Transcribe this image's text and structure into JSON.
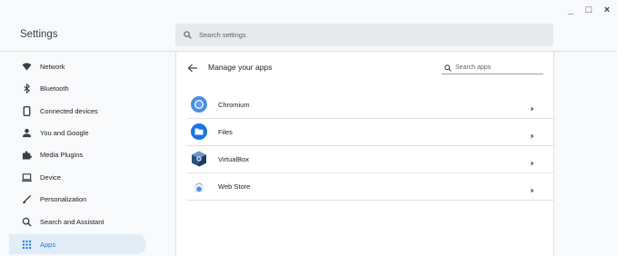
{
  "window": {
    "minimize": "_",
    "maximize": "□",
    "close": "×"
  },
  "header": {
    "title": "Settings",
    "search_placeholder": "Search settings"
  },
  "sidebar": {
    "items": [
      {
        "label": "Network",
        "icon": "wifi-icon"
      },
      {
        "label": "Bluetooth",
        "icon": "bluetooth-icon"
      },
      {
        "label": "Connected devices",
        "icon": "phone-icon"
      },
      {
        "label": "You and Google",
        "icon": "person-icon"
      },
      {
        "label": "Media Plugins",
        "icon": "puzzle-icon"
      },
      {
        "label": "Device",
        "icon": "laptop-icon"
      },
      {
        "label": "Personalization",
        "icon": "brush-icon"
      },
      {
        "label": "Search and Assistant",
        "icon": "search-icon"
      },
      {
        "label": "Apps",
        "icon": "apps-grid-icon",
        "active": true
      }
    ]
  },
  "main": {
    "title": "Manage your apps",
    "search_placeholder": "Search apps",
    "apps": [
      {
        "name": "Chromium",
        "icon": "chromium-icon"
      },
      {
        "name": "Files",
        "icon": "files-icon"
      },
      {
        "name": "VirtualBox",
        "icon": "virtualbox-icon"
      },
      {
        "name": "Web Store",
        "icon": "web-store-icon"
      }
    ]
  },
  "colors": {
    "accent": "#1a73e8",
    "active_bg": "#e1eef8",
    "search_bg": "#e5eaea",
    "page_bg": "#f8f9fa"
  }
}
